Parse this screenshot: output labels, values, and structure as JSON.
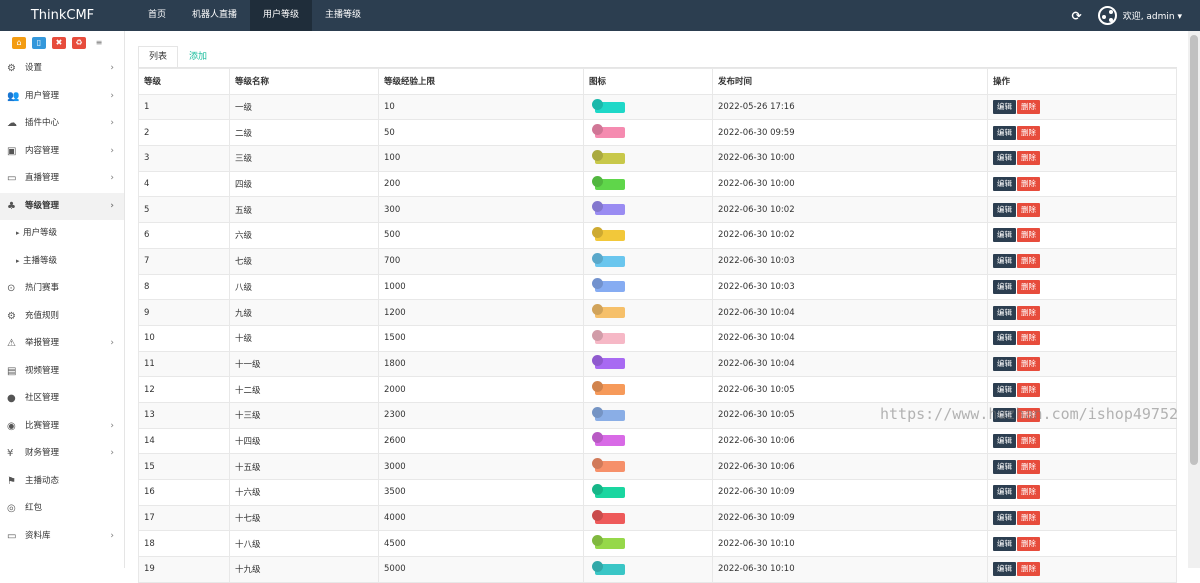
{
  "brand": "ThinkCMF",
  "topnav": [
    "首页",
    "机器人直播",
    "用户等级",
    "主播等级"
  ],
  "welcome": "欢迎, admin ▾",
  "colors": {
    "topbar": "#2c3e50",
    "accent": "#18bc9c",
    "danger": "#e74c3c"
  },
  "toolbar": [
    {
      "icon": "home-icon",
      "color": "#f39c12"
    },
    {
      "icon": "file-icon",
      "color": "#3498db"
    },
    {
      "icon": "trash-icon",
      "color": "#e74c3c"
    },
    {
      "icon": "recycle-icon",
      "color": "#e74c3c"
    },
    {
      "icon": "list-icon",
      "color": "#777777"
    }
  ],
  "sidebar": [
    {
      "label": "设置",
      "icon": "⚙",
      "arrow": true
    },
    {
      "label": "用户管理",
      "icon": "👥",
      "arrow": true
    },
    {
      "label": "插件中心",
      "icon": "☁",
      "arrow": true
    },
    {
      "label": "内容管理",
      "icon": "▣",
      "arrow": true
    },
    {
      "label": "直播管理",
      "icon": "▭",
      "arrow": true
    },
    {
      "label": "等级管理",
      "icon": "♣",
      "arrow": true,
      "active": true
    },
    {
      "label": "用户等级",
      "icon": "▸",
      "sub": true
    },
    {
      "label": "主播等级",
      "icon": "▸",
      "sub": true
    },
    {
      "label": "热门赛事",
      "icon": "⊙"
    },
    {
      "label": "充值规则",
      "icon": "⚙"
    },
    {
      "label": "举报管理",
      "icon": "⚠",
      "arrow": true
    },
    {
      "label": "视频管理",
      "icon": "▤"
    },
    {
      "label": "社区管理",
      "icon": "●"
    },
    {
      "label": "比赛管理",
      "icon": "◉",
      "arrow": true
    },
    {
      "label": "财务管理",
      "icon": "¥",
      "arrow": true
    },
    {
      "label": "主播动态",
      "icon": "⚑"
    },
    {
      "label": "红包",
      "icon": "◎"
    },
    {
      "label": "资料库",
      "icon": "▭",
      "arrow": true
    }
  ],
  "tabs": [
    "列表",
    "添加"
  ],
  "table": {
    "headers": [
      "等级",
      "等级名称",
      "等级经验上限",
      "图标",
      "发布时间",
      "操作"
    ],
    "edit": "编辑",
    "del": "删除",
    "rows": [
      [
        "1",
        "一级",
        "10",
        "#1fd8c8",
        "2022-05-26 17:16"
      ],
      [
        "2",
        "二级",
        "50",
        "#f58bb0",
        "2022-06-30 09:59"
      ],
      [
        "3",
        "三级",
        "100",
        "#c8c84a",
        "2022-06-30 10:00"
      ],
      [
        "4",
        "四级",
        "200",
        "#5fd64a",
        "2022-06-30 10:00"
      ],
      [
        "5",
        "五级",
        "300",
        "#9a8cf2",
        "2022-06-30 10:02"
      ],
      [
        "6",
        "六级",
        "500",
        "#f2c83a",
        "2022-06-30 10:02"
      ],
      [
        "7",
        "七级",
        "700",
        "#6ac6ee",
        "2022-06-30 10:03"
      ],
      [
        "8",
        "八级",
        "1000",
        "#86acf2",
        "2022-06-30 10:03"
      ],
      [
        "9",
        "九级",
        "1200",
        "#f6c06a",
        "2022-06-30 10:04"
      ],
      [
        "10",
        "十级",
        "1500",
        "#f6b8c6",
        "2022-06-30 10:04"
      ],
      [
        "11",
        "十一级",
        "1800",
        "#a86af2",
        "2022-06-30 10:04"
      ],
      [
        "12",
        "十二级",
        "2000",
        "#f69a5a",
        "2022-06-30 10:05"
      ],
      [
        "13",
        "十三级",
        "2300",
        "#8aaee6",
        "2022-06-30 10:05"
      ],
      [
        "14",
        "十四级",
        "2600",
        "#d86ae6",
        "2022-06-30 10:06"
      ],
      [
        "15",
        "十五级",
        "3000",
        "#f6906a",
        "2022-06-30 10:06"
      ],
      [
        "16",
        "十六级",
        "3500",
        "#1ad6a0",
        "2022-06-30 10:09"
      ],
      [
        "17",
        "十七级",
        "4000",
        "#ee5a5a",
        "2022-06-30 10:09"
      ],
      [
        "18",
        "十八级",
        "4500",
        "#96d84a",
        "2022-06-30 10:10"
      ],
      [
        "19",
        "十九级",
        "5000",
        "#3ac6c6",
        "2022-06-30 10:10"
      ]
    ]
  },
  "watermark": "https://www.huzhan.com/ishop49752"
}
